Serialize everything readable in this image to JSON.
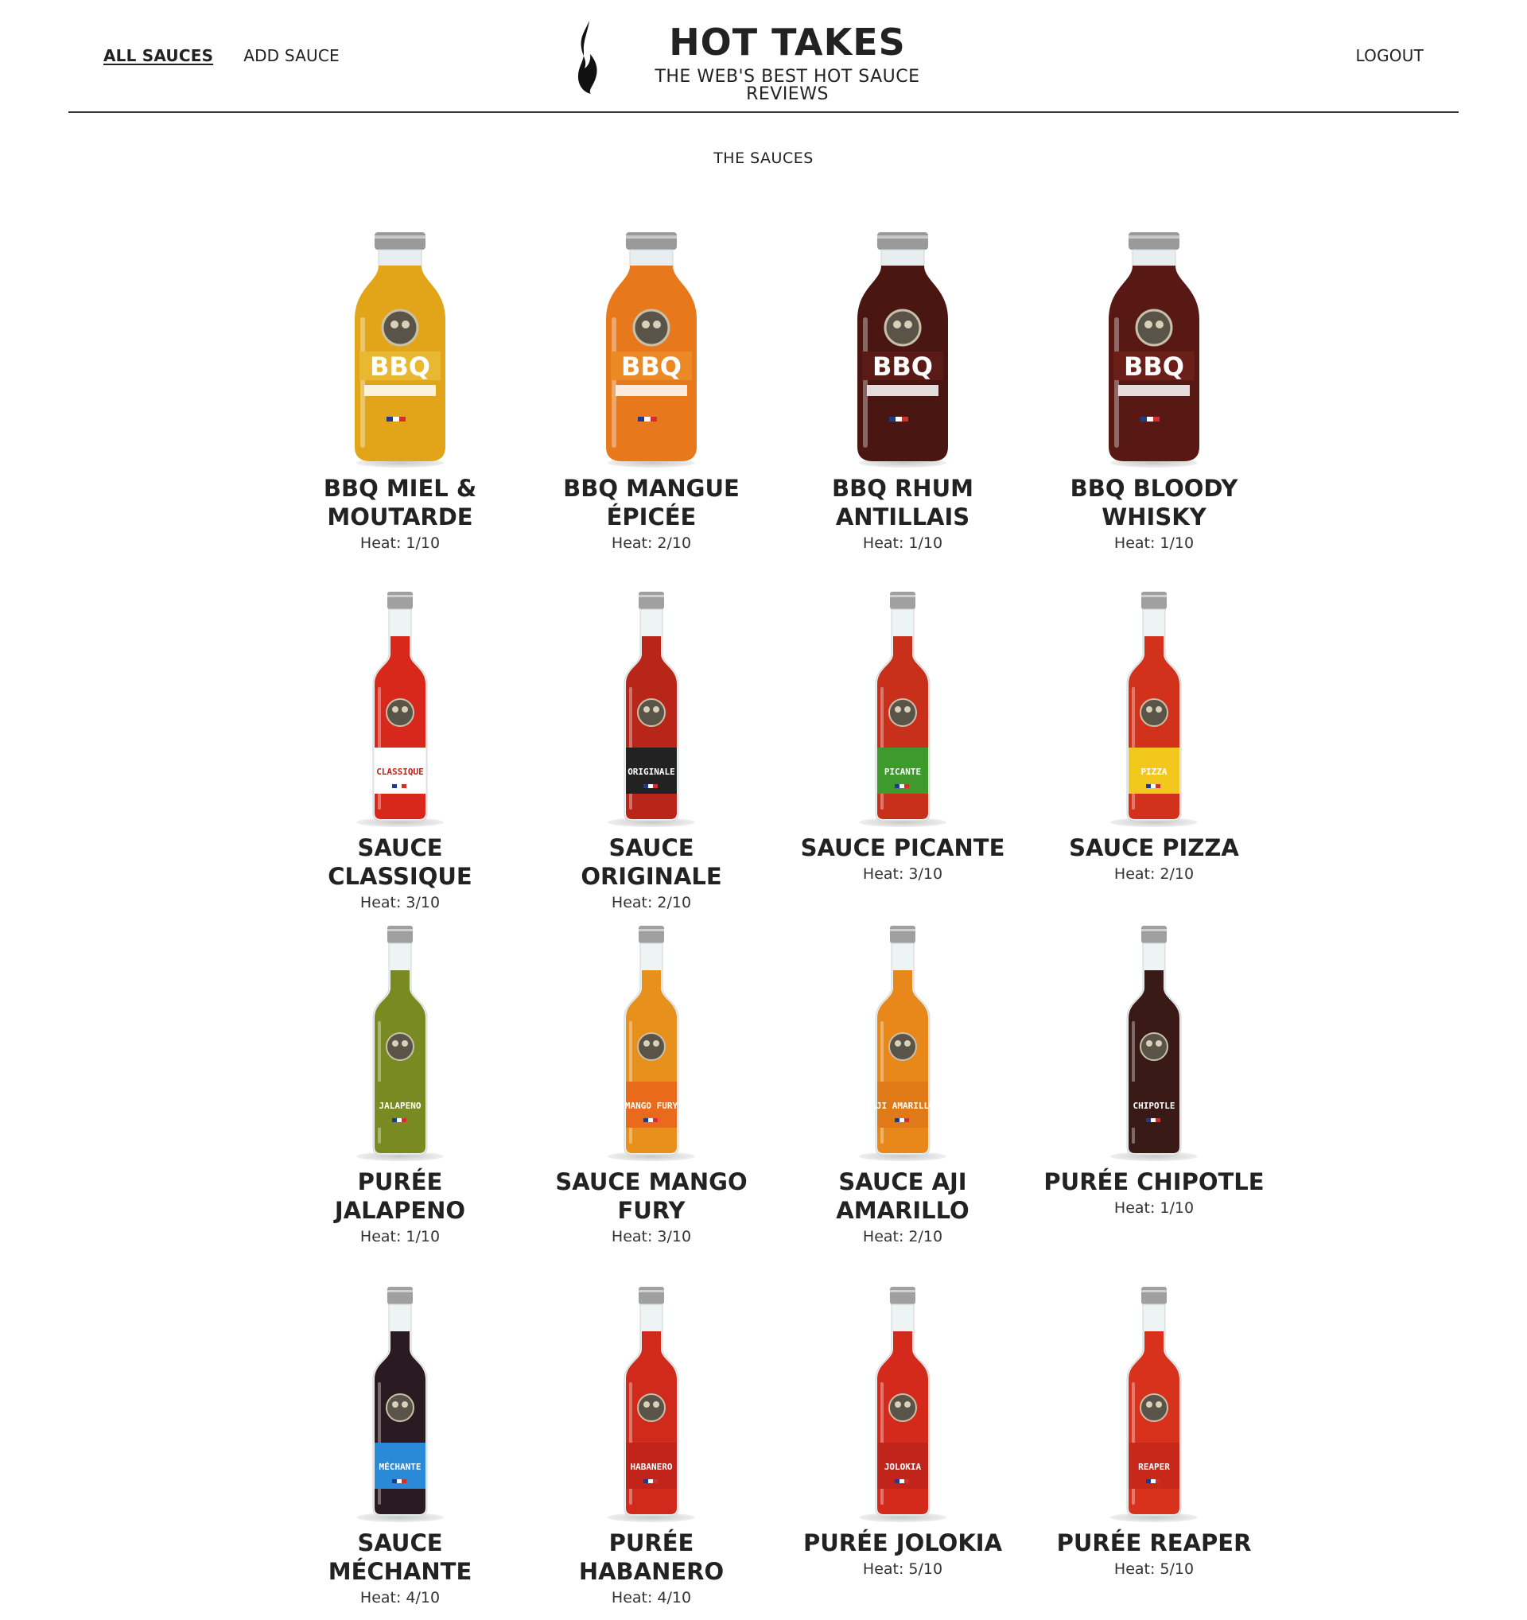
{
  "nav": {
    "all_sauces": "ALL SAUCES",
    "add_sauce": "ADD SAUCE",
    "logout": "LOGOUT"
  },
  "brand": {
    "title": "HOT TAKES",
    "subtitle": "THE WEB'S BEST HOT SAUCE REVIEWS",
    "logo_icon": "flame-icon"
  },
  "section_title": "THE SAUCES",
  "sauces": [
    {
      "name": "BBQ MIEL & MOUTARDE",
      "heat": "Heat: 1/10",
      "style": "jar",
      "color": "#e2a51a",
      "label": "#e8b832",
      "label_text": "BBQ"
    },
    {
      "name": "BBQ MANGUE ÉPICÉE",
      "heat": "Heat: 2/10",
      "style": "jar",
      "color": "#e8781c",
      "label": "#eb8a25",
      "label_text": "BBQ"
    },
    {
      "name": "BBQ RHUM ANTILLAIS",
      "heat": "Heat: 1/10",
      "style": "jar",
      "color": "#4a1612",
      "label": "#5a1a15",
      "label_text": "BBQ"
    },
    {
      "name": "BBQ BLOODY WHISKY",
      "heat": "Heat: 1/10",
      "style": "jar",
      "color": "#581814",
      "label": "#6b1f19",
      "label_text": "BBQ"
    },
    {
      "name": "SAUCE CLASSIQUE",
      "heat": "Heat: 3/10",
      "style": "bottle",
      "color": "#d8281c",
      "label": "#ffffff",
      "label_text": "CLASSIQUE"
    },
    {
      "name": "SAUCE ORIGINALE",
      "heat": "Heat: 2/10",
      "style": "bottle",
      "color": "#b8261a",
      "label": "#222222",
      "label_text": "ORIGINALE"
    },
    {
      "name": "SAUCE PICANTE",
      "heat": "Heat: 3/10",
      "style": "bottle",
      "color": "#c8301c",
      "label": "#3e9a2c",
      "label_text": "PICANTE"
    },
    {
      "name": "SAUCE PIZZA",
      "heat": "Heat: 2/10",
      "style": "bottle",
      "color": "#d2321c",
      "label": "#f2c81e",
      "label_text": "PIZZA"
    },
    {
      "name": "PURÉE JALAPENO",
      "heat": "Heat: 1/10",
      "style": "bottle",
      "color": "#7a8a22",
      "label": "#7a8a22",
      "label_text": "JALAPENO"
    },
    {
      "name": "SAUCE MANGO FURY",
      "heat": "Heat: 3/10",
      "style": "bottle",
      "color": "#e8901c",
      "label": "#e86a1a",
      "label_text": "MANGO FURY"
    },
    {
      "name": "SAUCE AJI AMARILLO",
      "heat": "Heat: 2/10",
      "style": "bottle",
      "color": "#e8881a",
      "label": "#e07a18",
      "label_text": "AJI AMARILLO"
    },
    {
      "name": "PURÉE CHIPOTLE",
      "heat": "Heat: 1/10",
      "style": "bottle",
      "color": "#3a1a16",
      "label": "#3a1a16",
      "label_text": "CHIPOTLE"
    },
    {
      "name": "SAUCE MÉCHANTE",
      "heat": "Heat: 4/10",
      "style": "bottle",
      "color": "#2a1a22",
      "label": "#2b8ad8",
      "label_text": "MÉCHANTE"
    },
    {
      "name": "PURÉE HABANERO",
      "heat": "Heat: 4/10",
      "style": "bottle",
      "color": "#d02a1c",
      "label": "#c0241a",
      "label_text": "HABANERO"
    },
    {
      "name": "PURÉE JOLOKIA",
      "heat": "Heat: 5/10",
      "style": "bottle",
      "color": "#d42a1c",
      "label": "#c0241a",
      "label_text": "JOLOKIA"
    },
    {
      "name": "PURÉE REAPER",
      "heat": "Heat: 5/10",
      "style": "bottle",
      "color": "#d8321c",
      "label": "#c8281a",
      "label_text": "REAPER"
    }
  ]
}
